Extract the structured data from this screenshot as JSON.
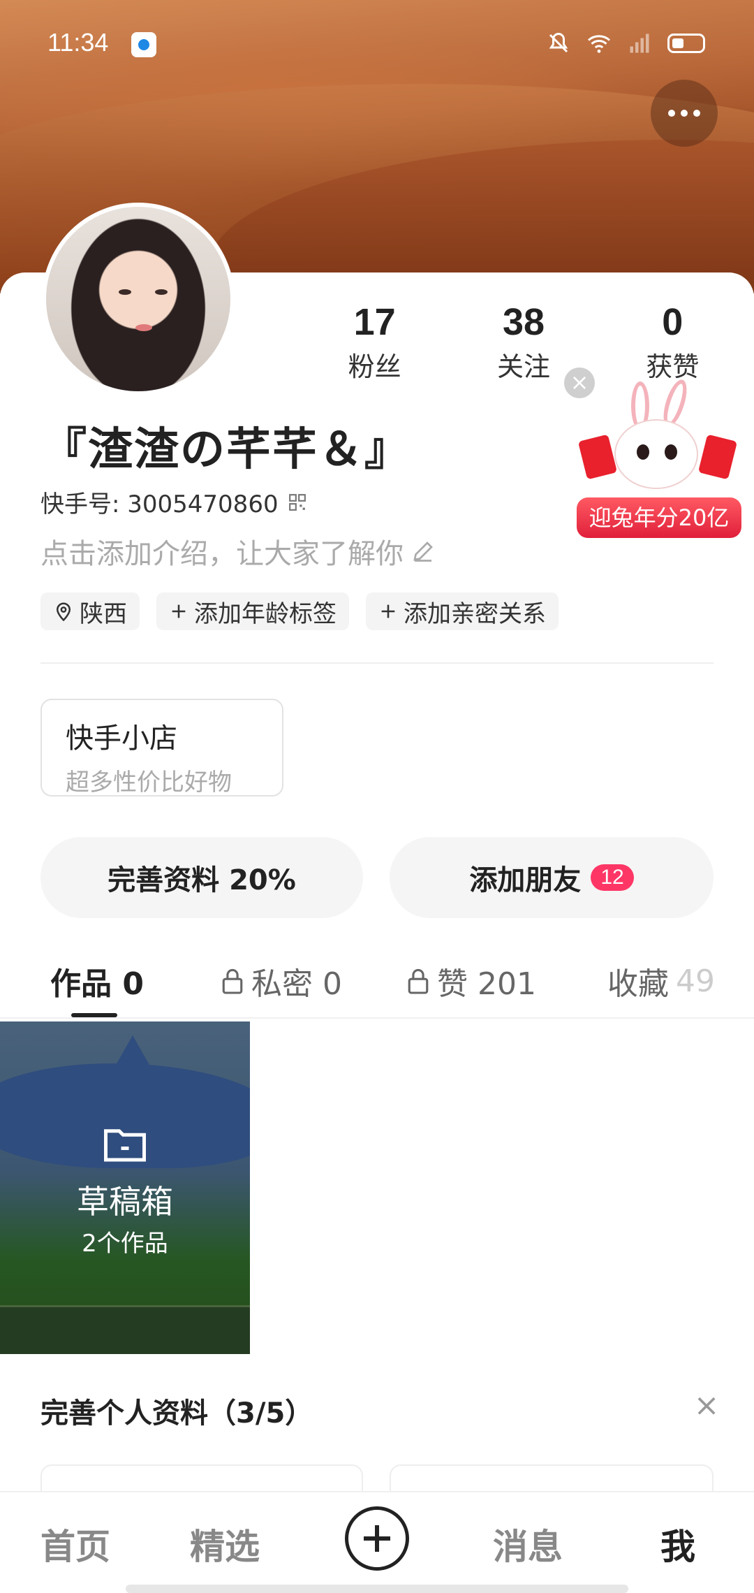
{
  "status_bar": {
    "time": "11:34"
  },
  "profile": {
    "followers_count": "17",
    "followers_label": "粉丝",
    "following_count": "38",
    "following_label": "关注",
    "likes_count": "0",
    "likes_label": "获赞",
    "nickname": "『渣渣の芊芊＆』",
    "kuaishou_id": "快手号: 3005470860",
    "intro_placeholder": "点击添加介绍，让大家了解你",
    "tags": [
      {
        "label": "陕西",
        "icon": "location-icon"
      },
      {
        "label": "添加年龄标签",
        "icon": "plus-icon"
      },
      {
        "label": "添加亲密关系",
        "icon": "plus-icon"
      }
    ]
  },
  "promo": {
    "label": "迎兔年分20亿"
  },
  "shop": {
    "title": "快手小店",
    "subtitle": "超多性价比好物"
  },
  "actions": {
    "complete_profile": "完善资料 20%",
    "add_friends": "添加朋友",
    "add_friends_badge": "12"
  },
  "tabs": [
    {
      "label": "作品 0",
      "active": true
    },
    {
      "label": "私密 0",
      "locked": true
    },
    {
      "label": "赞 201",
      "locked": true
    },
    {
      "label": "收藏",
      "count": "49"
    }
  ],
  "draft": {
    "title": "草稿箱",
    "count": "2个作品"
  },
  "profile_completion": {
    "title": "完善个人资料（3/5）"
  },
  "bottom_nav": {
    "home": "首页",
    "featured": "精选",
    "messages": "消息",
    "me": "我"
  },
  "colors": {
    "accent": "#fe3666",
    "promo_red": "#e01f3a"
  }
}
